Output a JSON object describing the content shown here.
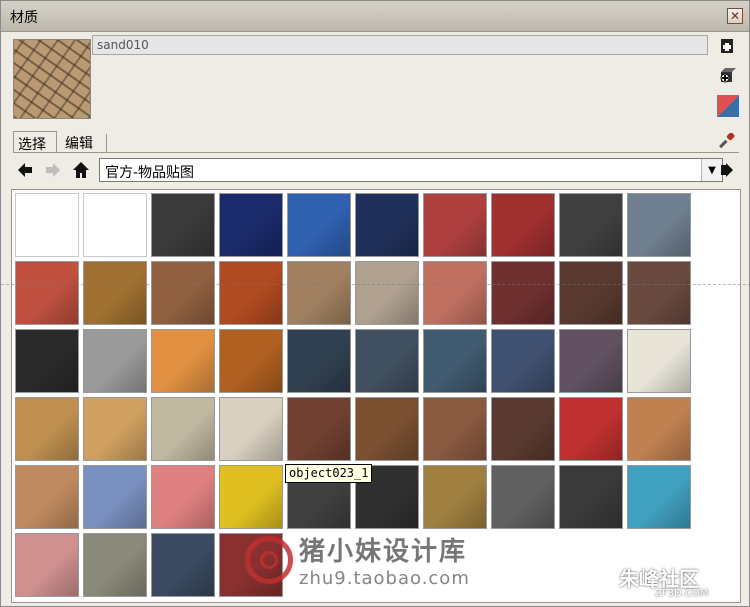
{
  "window": {
    "title": "材质",
    "close_glyph": "✕"
  },
  "material": {
    "name": "sand010"
  },
  "tabs": [
    {
      "label": "选择",
      "active": true
    },
    {
      "label": "编辑",
      "active": false
    }
  ],
  "collection": {
    "selected": "官方-物品贴图"
  },
  "tooltip": "object023_1",
  "watermarks": {
    "brand": "猪小妹设计库",
    "url": "zhu9.taobao.com",
    "corner": "朱峰社区",
    "corner_sub": "ZF3D.COM"
  },
  "icons": {
    "create": "create-material-icon",
    "add_to_model": "add-to-model-icon",
    "default": "default-material-icon",
    "sample": "eyedropper-icon",
    "back": "back-arrow-icon",
    "forward": "forward-arrow-icon",
    "home": "home-icon",
    "details": "details-arrow-icon"
  },
  "swatches": [
    [
      "#ffffff",
      "#ffffff",
      "#3a3a3a",
      "#1a2a6a",
      "#3060b0",
      "#20305a",
      "#b04040",
      "#a03030",
      "#404040",
      "#708090"
    ],
    [
      "#c05040",
      "#a07030",
      "#906040",
      "#b04a20",
      "#a08060",
      "#b0a090",
      "#c07060",
      "#703030",
      "#5a3a30",
      "#6a4a40"
    ],
    [
      "#2a2a2a",
      "#9a9a9a",
      "#e09040",
      "#b06020",
      "#304050",
      "#405060",
      "#405a70",
      "#405070",
      "#605060",
      "#e8e4d8"
    ],
    [
      "#c09050",
      "#d0a060",
      "#c0b8a0",
      "#d8d0c0",
      "#704030",
      "#7a5030",
      "#8a5a40",
      "#5a3a30",
      "#c03030",
      "#c08050"
    ],
    [
      "#c08a60",
      "#7a90c0",
      "#e08080",
      "#e0c020",
      "#404040",
      "#303030",
      "#a08040",
      "#606060",
      "#3a3a3a",
      "#40a0c0"
    ],
    [
      "#d09090",
      "#8a8a7a",
      "#3a4a60",
      "#8a3030"
    ]
  ]
}
